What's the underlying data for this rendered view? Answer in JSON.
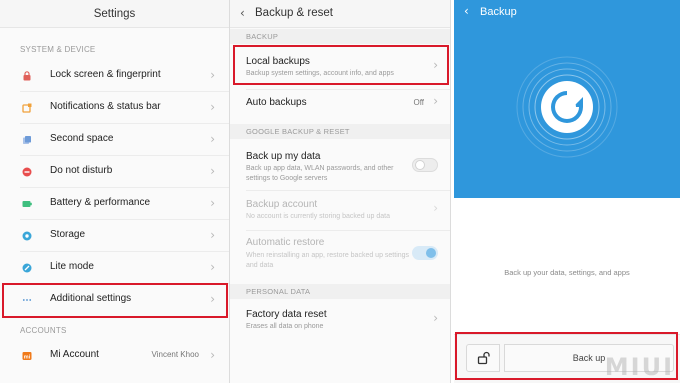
{
  "settings": {
    "title": "Settings",
    "section_system": "SYSTEM & DEVICE",
    "items": [
      {
        "label": "Lock screen & fingerprint",
        "icon": "lock-icon",
        "color": "#e0605a"
      },
      {
        "label": "Notifications & status bar",
        "icon": "notification-icon",
        "color": "#f0a13a"
      },
      {
        "label": "Second space",
        "icon": "second-space-icon",
        "color": "#6e9bd8"
      },
      {
        "label": "Do not disturb",
        "icon": "do-not-disturb-icon",
        "color": "#e84d4d"
      },
      {
        "label": "Battery & performance",
        "icon": "battery-icon",
        "color": "#3fbf7f"
      },
      {
        "label": "Storage",
        "icon": "storage-icon",
        "color": "#3aa6d8"
      },
      {
        "label": "Lite mode",
        "icon": "lite-mode-icon",
        "color": "#3aa6d8"
      },
      {
        "label": "Additional settings",
        "icon": "more-icon",
        "color": "#8b8b8b"
      }
    ],
    "section_accounts": "ACCOUNTS",
    "account": {
      "label": "Mi Account",
      "value": "Vincent Khoo",
      "icon": "mi-icon",
      "color": "#f07a1a"
    }
  },
  "backup_reset": {
    "title": "Backup & reset",
    "section_backup": "BACKUP",
    "local_backups": {
      "title": "Local backups",
      "subtitle": "Backup system settings, account info, and apps"
    },
    "auto_backups": {
      "title": "Auto backups",
      "value": "Off"
    },
    "section_google": "GOOGLE BACKUP & RESET",
    "back_up_data": {
      "title": "Back up my data",
      "subtitle": "Back up app data, WLAN passwords, and other settings to Google servers"
    },
    "backup_account": {
      "title": "Backup account",
      "subtitle": "No account is currently storing backed up data"
    },
    "auto_restore": {
      "title": "Automatic restore",
      "subtitle": "When reinstalling an app, restore backed up settings and data"
    },
    "section_personal": "PERSONAL DATA",
    "factory_reset": {
      "title": "Factory data reset",
      "subtitle": "Erases all data on phone"
    }
  },
  "backup_screen": {
    "title": "Backup",
    "description": "Back up your data, settings, and apps",
    "button_label": "Back up",
    "accent": "#2f97dc"
  },
  "highlight_color": "#d9192a",
  "watermark": "MIUI"
}
